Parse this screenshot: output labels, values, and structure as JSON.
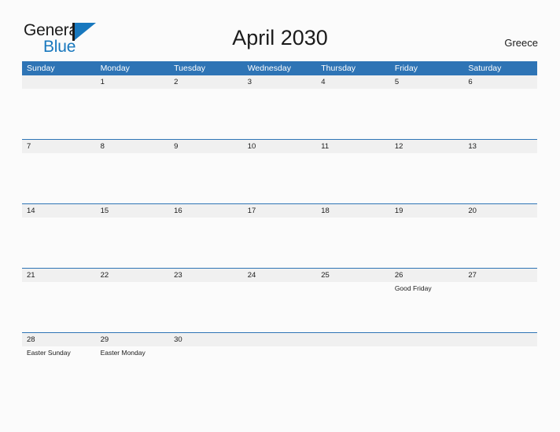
{
  "brand": {
    "name_part1": "General",
    "name_part2": "Blue",
    "flag_icon": "blue-triangle-flag-icon",
    "colors": {
      "part1": "#1b1b1b",
      "part2": "#1878be",
      "flag": "#1878be"
    }
  },
  "header": {
    "title": "April 2030",
    "region": "Greece"
  },
  "theme": {
    "header_blue": "#2e74b5",
    "day_band_gray": "#f0f0f0",
    "page_background": "#fbfbfb",
    "text": "#1b1b1b"
  },
  "calendar": {
    "weekdays": [
      "Sunday",
      "Monday",
      "Tuesday",
      "Wednesday",
      "Thursday",
      "Friday",
      "Saturday"
    ],
    "weeks": [
      {
        "days": [
          {
            "number": "",
            "events": []
          },
          {
            "number": "1",
            "events": []
          },
          {
            "number": "2",
            "events": []
          },
          {
            "number": "3",
            "events": []
          },
          {
            "number": "4",
            "events": []
          },
          {
            "number": "5",
            "events": []
          },
          {
            "number": "6",
            "events": []
          }
        ]
      },
      {
        "days": [
          {
            "number": "7",
            "events": []
          },
          {
            "number": "8",
            "events": []
          },
          {
            "number": "9",
            "events": []
          },
          {
            "number": "10",
            "events": []
          },
          {
            "number": "11",
            "events": []
          },
          {
            "number": "12",
            "events": []
          },
          {
            "number": "13",
            "events": []
          }
        ]
      },
      {
        "days": [
          {
            "number": "14",
            "events": []
          },
          {
            "number": "15",
            "events": []
          },
          {
            "number": "16",
            "events": []
          },
          {
            "number": "17",
            "events": []
          },
          {
            "number": "18",
            "events": []
          },
          {
            "number": "19",
            "events": []
          },
          {
            "number": "20",
            "events": []
          }
        ]
      },
      {
        "days": [
          {
            "number": "21",
            "events": []
          },
          {
            "number": "22",
            "events": []
          },
          {
            "number": "23",
            "events": []
          },
          {
            "number": "24",
            "events": []
          },
          {
            "number": "25",
            "events": []
          },
          {
            "number": "26",
            "events": [
              "Good Friday"
            ]
          },
          {
            "number": "27",
            "events": []
          }
        ]
      },
      {
        "days": [
          {
            "number": "28",
            "events": [
              "Easter Sunday"
            ]
          },
          {
            "number": "29",
            "events": [
              "Easter Monday"
            ]
          },
          {
            "number": "30",
            "events": []
          },
          {
            "number": "",
            "events": []
          },
          {
            "number": "",
            "events": []
          },
          {
            "number": "",
            "events": []
          },
          {
            "number": "",
            "events": []
          }
        ]
      }
    ]
  }
}
